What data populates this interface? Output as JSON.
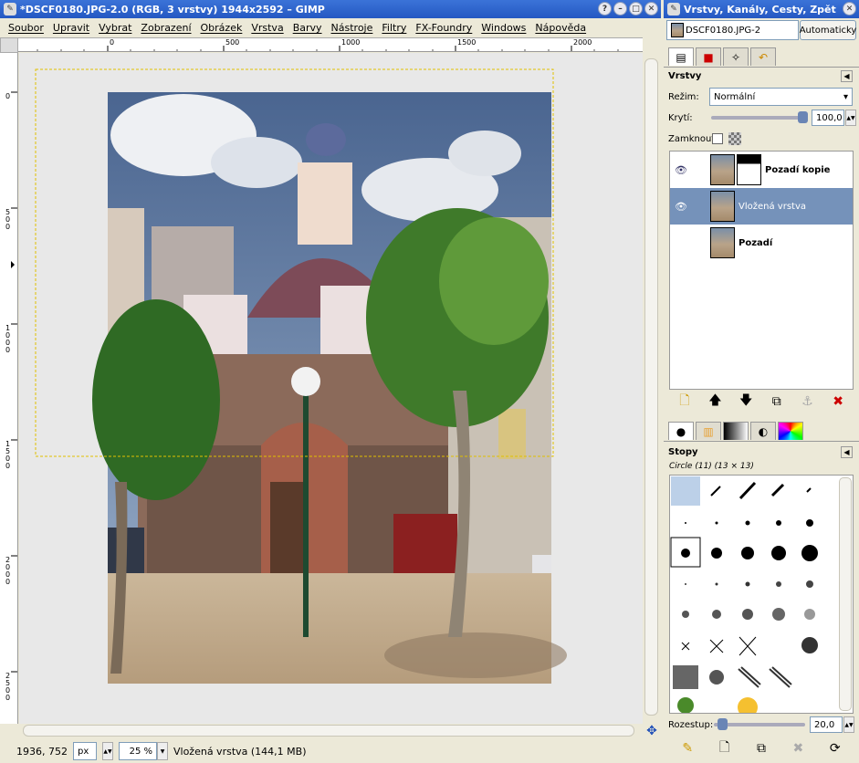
{
  "window": {
    "title": "*DSCF0180.JPG-2.0 (RGB, 3 vrstvy) 1944x2592 – GIMP",
    "menus": [
      "Soubor",
      "Upravit",
      "Vybrat",
      "Zobrazení",
      "Obrázek",
      "Vrstva",
      "Barvy",
      "Nástroje",
      "Filtry",
      "FX-Foundry",
      "Windows",
      "Nápověda"
    ]
  },
  "rulers": {
    "h_ticks": [
      "0",
      "500",
      "1000",
      "1500",
      "2000"
    ],
    "v_ticks": [
      "0",
      "500",
      "1000",
      "1500",
      "2000",
      "2500"
    ]
  },
  "status": {
    "coords": "1936, 752",
    "unit": "px",
    "zoom": "25 %",
    "message": "Vložená vrstva (144,1 MB)"
  },
  "dock": {
    "title": "Vrstvy, Kanály, Cesty, Zpět",
    "image_select": "DSCF0180.JPG-2",
    "auto_button": "Automaticky",
    "layers_panel": {
      "title": "Vrstvy",
      "mode_label": "Režim:",
      "mode_value": "Normální",
      "opacity_label": "Krytí:",
      "opacity_value": "100,0",
      "opacity": 1.0,
      "lock_label": "Zamknout:",
      "layers": [
        {
          "name": "Pozadí kopie",
          "visible": true,
          "selected": false
        },
        {
          "name": "Vložená vrstva",
          "visible": true,
          "selected": true
        },
        {
          "name": "Pozadí",
          "visible": false,
          "selected": false
        }
      ]
    },
    "brushes_panel": {
      "title": "Stopy",
      "current": "Circle (11) (13 × 13)",
      "spacing_label": "Rozestup:",
      "spacing_value": "20,0",
      "spacing": 0.2
    }
  },
  "colors": {
    "accent": "#2458c2",
    "selected_row": "#7592ba",
    "selection_marquee": "#e0c000"
  }
}
